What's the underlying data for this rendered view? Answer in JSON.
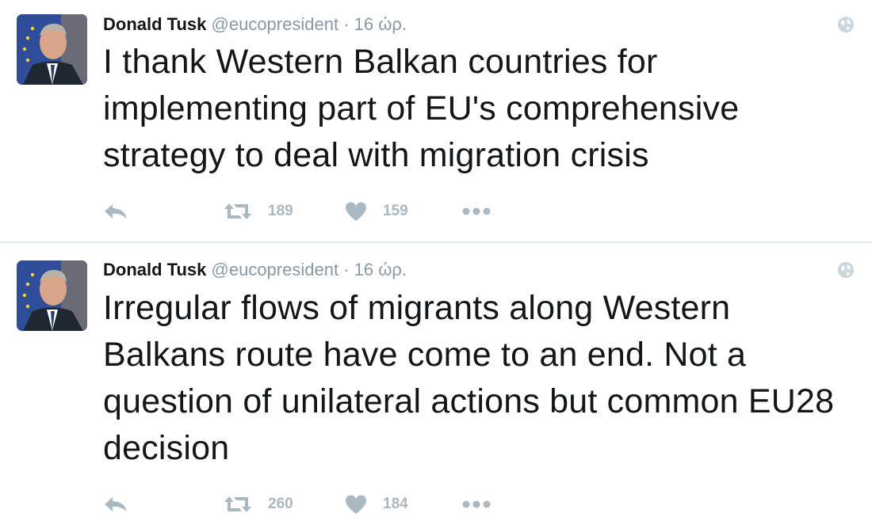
{
  "colors": {
    "text": "#14171a",
    "meta": "#8899a6",
    "action": "#aab8c2",
    "divider": "#e6ecf0"
  },
  "tweets": [
    {
      "author": "Donald Tusk",
      "handle": "@eucopresident",
      "separator": "·",
      "time": "16 ώρ.",
      "text": "I thank Western Balkan countries for implementing part of EU's comprehensive strategy to deal with migration crisis",
      "retweets": "189",
      "likes": "159"
    },
    {
      "author": "Donald Tusk",
      "handle": "@eucopresident",
      "separator": "·",
      "time": "16 ώρ.",
      "text": "Irregular flows of migrants along Western Balkans route have come to an end. Not a question of unilateral actions but common EU28 decision",
      "retweets": "260",
      "likes": "184"
    }
  ],
  "icons": {
    "reply": "reply-icon",
    "retweet": "retweet-icon",
    "like": "heart-icon",
    "more": "more-icon",
    "globe": "globe-icon"
  }
}
